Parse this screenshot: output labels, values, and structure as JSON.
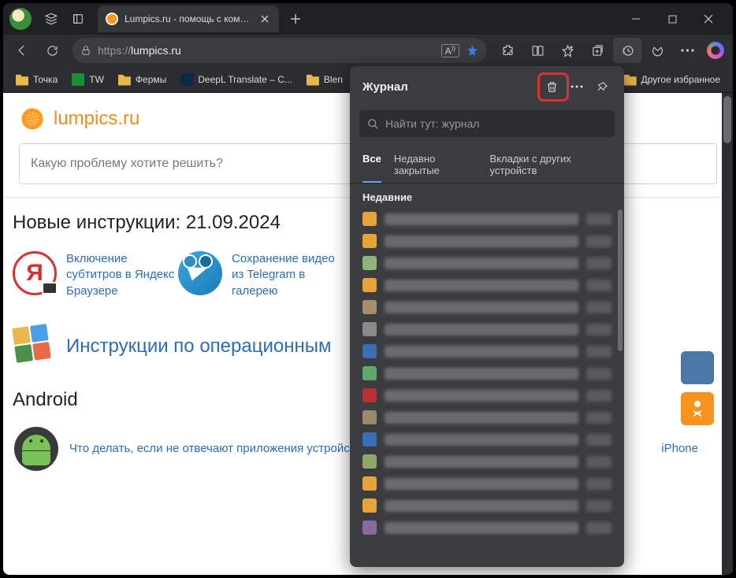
{
  "tab": {
    "title": "Lumpics.ru - помощь с компьют"
  },
  "addr": {
    "prefix": "https://",
    "domain": "lumpics.ru"
  },
  "bookmarks": {
    "tochka": "Точка",
    "tw": "TW",
    "fermy": "Фермы",
    "deepl": "DeepL Translate – С...",
    "blen": "Blen",
    "other": "Другое избранное"
  },
  "site": {
    "name": "lumpics.ru"
  },
  "search": {
    "placeholder": "Какую проблему хотите решить?"
  },
  "sections": {
    "new_instructions": "Новые инструкции: 21.09.2024",
    "android": "Android"
  },
  "cards": {
    "yandex": "Включение субтитров в Яндекс Браузере",
    "telegram": "Сохранение видео из Telegram в галерею"
  },
  "os_link": "Инструкции по операционным",
  "android_link": "Что делать, если не отвечают приложения устройстве с Android",
  "iphone_label": "iPhone",
  "history": {
    "title": "Журнал",
    "search_placeholder": "Найти тут: журнал",
    "tabs": {
      "all": "Все",
      "recent": "Недавно закрытые",
      "other": "Вкладки с других устройств"
    },
    "section_recent": "Недавние"
  },
  "favColors": [
    "#e8a23a",
    "#e8a23a",
    "#8fb57a",
    "#e8a23a",
    "#a5906a",
    "#8a8a8a",
    "#3a6fb8",
    "#5fa868",
    "#b83030",
    "#9a8a6a",
    "#3a6fb8",
    "#8fa868",
    "#e8a23a",
    "#e8a23a",
    "#8a6a9a"
  ]
}
